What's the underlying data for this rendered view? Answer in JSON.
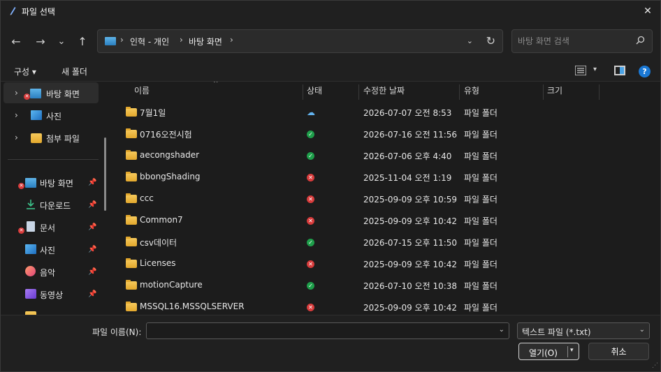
{
  "window": {
    "title": "파일 선택",
    "close_glyph": "✕"
  },
  "nav": {
    "back": "←",
    "forward": "→",
    "recent": "⌄",
    "up": "↑"
  },
  "address": {
    "crumbs": [
      "인혁 - 개인",
      "바탕 화면"
    ],
    "separator": "›",
    "dropdown_glyph": "⌄",
    "refresh_glyph": "↻"
  },
  "search": {
    "placeholder": "바탕 화면 검색",
    "icon": "search-icon"
  },
  "toolbar": {
    "organize_label": "구성 ▾",
    "new_folder_label": "새 폴더",
    "view_caret": "▾",
    "help_label": "?"
  },
  "sidebar": {
    "tree": [
      {
        "label": "바탕 화면",
        "icon": "desktop-icon",
        "selected": true,
        "error": true
      },
      {
        "label": "사진",
        "icon": "pictures-icon",
        "selected": false
      },
      {
        "label": "첨부 파일",
        "icon": "folder-icon",
        "selected": false
      }
    ],
    "quick": [
      {
        "label": "바탕 화면",
        "icon": "desktop-icon",
        "error": true
      },
      {
        "label": "다운로드",
        "icon": "download-icon"
      },
      {
        "label": "문서",
        "icon": "document-icon",
        "error": true
      },
      {
        "label": "사진",
        "icon": "pictures-icon"
      },
      {
        "label": "음악",
        "icon": "music-icon"
      },
      {
        "label": "동영상",
        "icon": "video-icon"
      }
    ],
    "pin_glyph": "📌",
    "chevron_glyph": "›"
  },
  "columns": {
    "name": "이름",
    "status": "상태",
    "modified": "수정한 날짜",
    "type": "유형",
    "size": "크기",
    "sort_glyph": "^"
  },
  "files": [
    {
      "name": "7월1일",
      "status": "cloud",
      "modified": "2026-07-07 오전 8:53",
      "type": "파일 폴더"
    },
    {
      "name": "0716오전시험",
      "status": "ok",
      "modified": "2026-07-16 오전 11:56",
      "type": "파일 폴더"
    },
    {
      "name": "aecongshader",
      "status": "ok",
      "modified": "2026-07-06 오후 4:40",
      "type": "파일 폴더"
    },
    {
      "name": "bbongShading",
      "status": "err",
      "modified": "2025-11-04 오전 1:19",
      "type": "파일 폴더"
    },
    {
      "name": "ccc",
      "status": "err",
      "modified": "2025-09-09 오후 10:59",
      "type": "파일 폴더"
    },
    {
      "name": "Common7",
      "status": "err",
      "modified": "2025-09-09 오후 10:42",
      "type": "파일 폴더"
    },
    {
      "name": "csv데이터",
      "status": "ok",
      "modified": "2026-07-15 오후 11:50",
      "type": "파일 폴더"
    },
    {
      "name": "Licenses",
      "status": "err",
      "modified": "2025-09-09 오후 10:42",
      "type": "파일 폴더"
    },
    {
      "name": "motionCapture",
      "status": "ok",
      "modified": "2026-07-10 오전 10:38",
      "type": "파일 폴더"
    },
    {
      "name": "MSSQL16.MSSQLSERVER",
      "status": "err",
      "modified": "2025-09-09 오후 10:42",
      "type": "파일 폴더"
    }
  ],
  "footer": {
    "filename_label": "파일 이름(N):",
    "filename_value": "",
    "filter_value": "텍스트 파일 (*.txt)",
    "open_label": "열기(O)",
    "cancel_label": "취소"
  }
}
